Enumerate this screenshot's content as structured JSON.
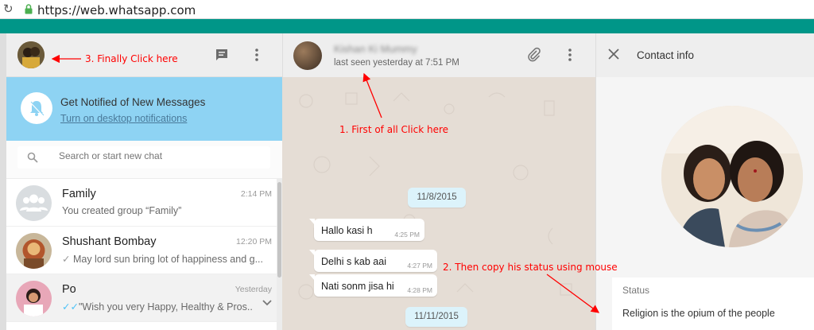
{
  "browser": {
    "url": "https://web.whatsapp.com"
  },
  "sidebar": {
    "notification": {
      "title": "Get Notified of New Messages",
      "link": "Turn on desktop notifications"
    },
    "search": {
      "placeholder": "Search or start new chat"
    },
    "chats": [
      {
        "name": "Family",
        "time": "2:14 PM",
        "preview": "You created group “Family”",
        "tick": ""
      },
      {
        "name": "Shushant Bombay",
        "time": "12:20 PM",
        "preview": "May lord sun bring lot of happiness and g...",
        "tick": "✓"
      },
      {
        "name": "Po",
        "time": "Yesterday",
        "preview": "\"Wish you very Happy, Healthy & Pros...",
        "tick": "✓✓"
      }
    ]
  },
  "conversation": {
    "contact_name": "Kishan Ki Mummy",
    "last_seen": "last seen yesterday at 7:51 PM",
    "date_1": "11/8/2015",
    "date_2": "11/11/2015",
    "messages": [
      {
        "text": "Hallo kasi h",
        "time": "4:25 PM"
      },
      {
        "text": "Delhi s kab aai",
        "time": "4:27 PM"
      },
      {
        "text": "Nati sonm jisa hi",
        "time": "4:28 PM"
      }
    ]
  },
  "contact_info": {
    "title": "Contact info",
    "status_label": "Status",
    "status_value": "Religion is the opium of the people"
  },
  "annotations": {
    "step1": "1. First of all Click here",
    "step2": "2. Then copy his status using mouse",
    "step3": "3. Finally Click here"
  },
  "colors": {
    "header_teal": "#009688",
    "notification_bg": "#8ed3f3",
    "annotation_red": "#ff0000",
    "chat_bg": "#e5ddd5",
    "date_chip": "#dcf3fb"
  },
  "icons": [
    "reload-icon",
    "lock-icon",
    "new-chat-icon",
    "menu-icon",
    "bell-off-icon",
    "search-icon",
    "group-icon",
    "attach-icon",
    "close-icon",
    "chevron-down-icon"
  ]
}
